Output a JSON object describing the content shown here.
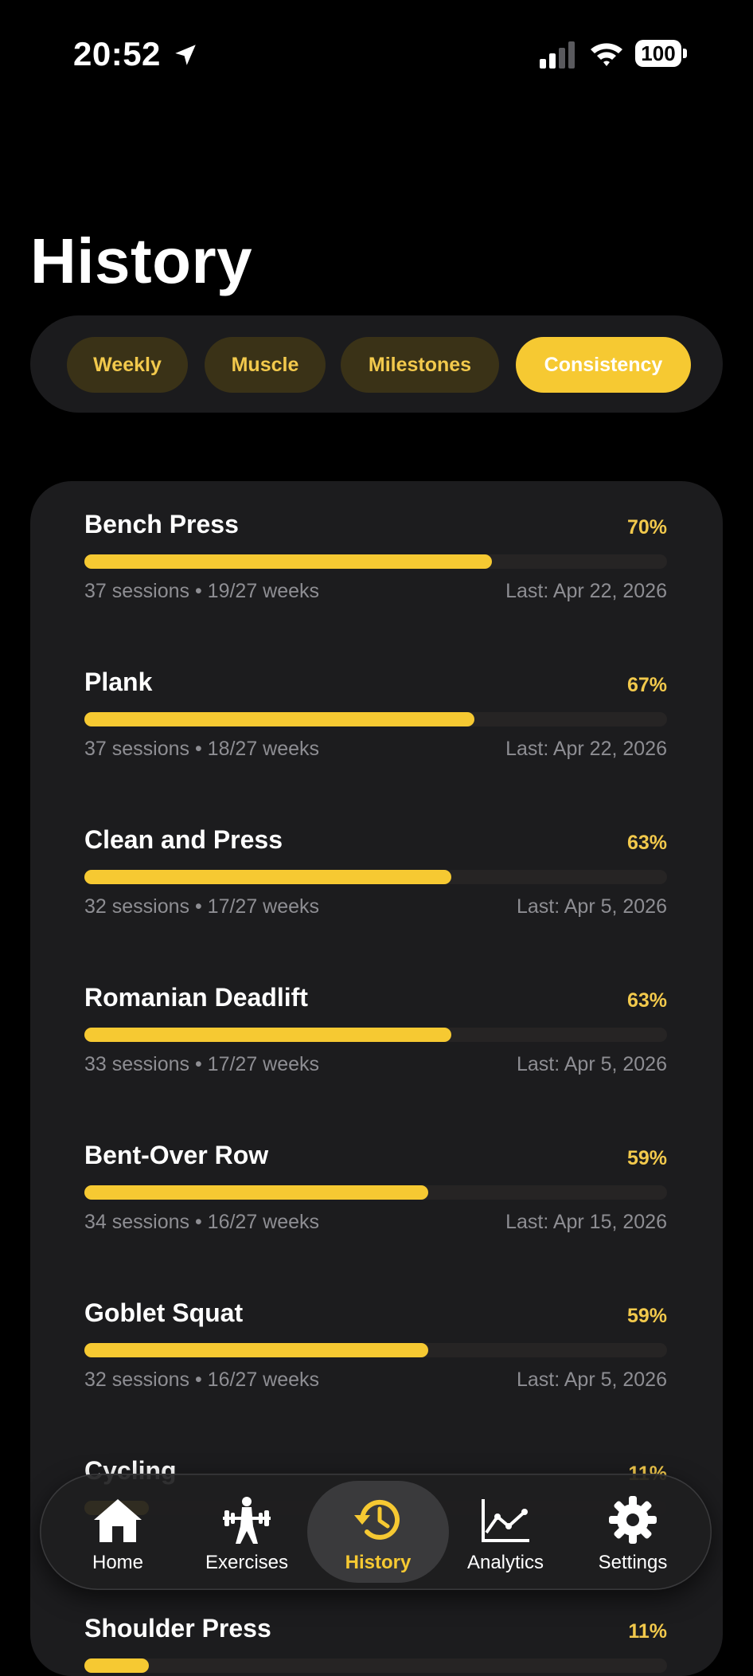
{
  "status": {
    "time": "20:52",
    "battery": "100"
  },
  "page": {
    "title": "History"
  },
  "tabs": [
    {
      "label": "Weekly",
      "active": false
    },
    {
      "label": "Muscle",
      "active": false
    },
    {
      "label": "Milestones",
      "active": false
    },
    {
      "label": "Consistency",
      "active": true
    }
  ],
  "exercises": [
    {
      "name": "Bench Press",
      "percent_label": "70%",
      "percent": 70,
      "meta": "37 sessions • 19/27 weeks",
      "last": "Last: Apr 22, 2026"
    },
    {
      "name": "Plank",
      "percent_label": "67%",
      "percent": 67,
      "meta": "37 sessions • 18/27 weeks",
      "last": "Last: Apr 22, 2026"
    },
    {
      "name": "Clean and Press",
      "percent_label": "63%",
      "percent": 63,
      "meta": "32 sessions • 17/27 weeks",
      "last": "Last: Apr 5, 2026"
    },
    {
      "name": "Romanian Deadlift",
      "percent_label": "63%",
      "percent": 63,
      "meta": "33 sessions • 17/27 weeks",
      "last": "Last: Apr 5, 2026"
    },
    {
      "name": "Bent-Over Row",
      "percent_label": "59%",
      "percent": 59,
      "meta": "34 sessions • 16/27 weeks",
      "last": "Last: Apr 15, 2026"
    },
    {
      "name": "Goblet Squat",
      "percent_label": "59%",
      "percent": 59,
      "meta": "32 sessions • 16/27 weeks",
      "last": "Last: Apr 5, 2026"
    },
    {
      "name": "Cycling",
      "percent_label": "11%",
      "percent": 11,
      "meta": "",
      "last": ""
    },
    {
      "name": "Shoulder Press",
      "percent_label": "11%",
      "percent": 11,
      "meta": "",
      "last": ""
    }
  ],
  "tabbar": [
    {
      "label": "Home",
      "icon": "home-icon",
      "active": false
    },
    {
      "label": "Exercises",
      "icon": "exercises-icon",
      "active": false
    },
    {
      "label": "History",
      "icon": "history-icon",
      "active": true
    },
    {
      "label": "Analytics",
      "icon": "analytics-icon",
      "active": false
    },
    {
      "label": "Settings",
      "icon": "settings-icon",
      "active": false
    }
  ],
  "colors": {
    "accent": "#f6c932",
    "tab_inactive_bg": "#3a3217",
    "card_bg": "#1c1c1e",
    "meta_text": "#8e8e93"
  }
}
